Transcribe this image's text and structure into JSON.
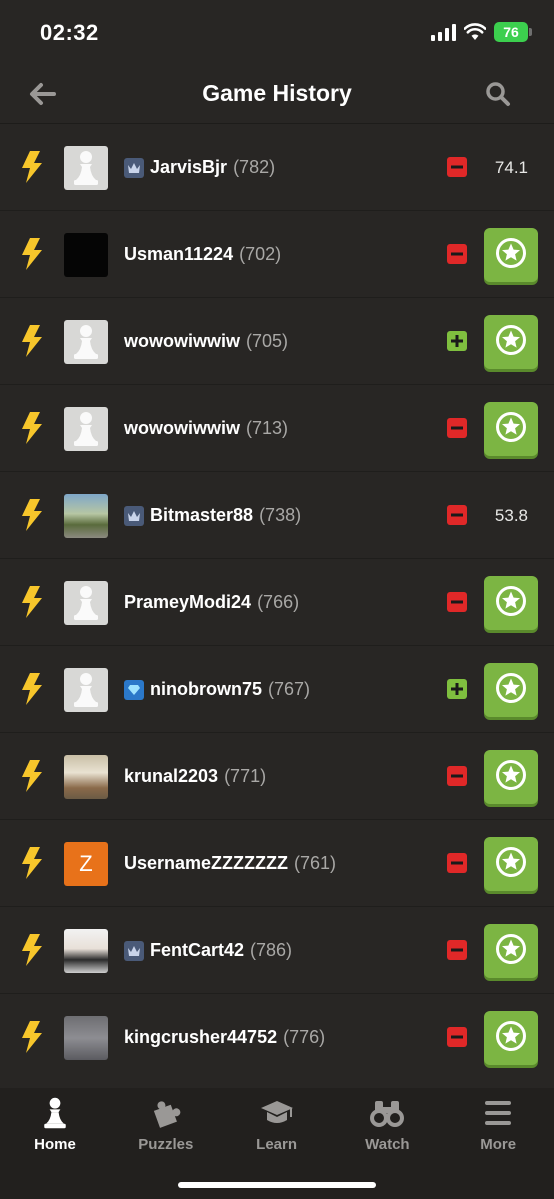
{
  "status": {
    "time": "02:32",
    "battery": "76"
  },
  "header": {
    "title": "Game History",
    "back_icon": "arrow-left-icon",
    "search_icon": "search-icon"
  },
  "games": [
    {
      "avatar": "pawn",
      "badge": "crown",
      "username": "JarvisBjr",
      "rating": "(782)",
      "result": "loss",
      "accuracy": "74.1"
    },
    {
      "avatar": "black",
      "badge": "",
      "username": "Usman11224",
      "rating": "(702)",
      "result": "loss",
      "accuracy": ""
    },
    {
      "avatar": "pawn",
      "badge": "",
      "username": "wowowiwwiw",
      "rating": "(705)",
      "result": "win",
      "accuracy": ""
    },
    {
      "avatar": "pawn",
      "badge": "",
      "username": "wowowiwwiw",
      "rating": "(713)",
      "result": "loss",
      "accuracy": ""
    },
    {
      "avatar": "photo1",
      "badge": "crown",
      "username": "Bitmaster88",
      "rating": "(738)",
      "result": "loss",
      "accuracy": "53.8"
    },
    {
      "avatar": "pawn",
      "badge": "",
      "username": "PrameyModi24",
      "rating": "(766)",
      "result": "loss",
      "accuracy": ""
    },
    {
      "avatar": "pawn",
      "badge": "diamond",
      "username": "ninobrown75",
      "rating": "(767)",
      "result": "win",
      "accuracy": ""
    },
    {
      "avatar": "photo2",
      "badge": "",
      "username": "krunal2203",
      "rating": "(771)",
      "result": "loss",
      "accuracy": ""
    },
    {
      "avatar": "letter",
      "avatar_letter": "Z",
      "badge": "",
      "username": "UsernameZZZZZZZ",
      "rating": "(761)",
      "result": "loss",
      "accuracy": ""
    },
    {
      "avatar": "photo3",
      "badge": "crown",
      "username": "FentCart42",
      "rating": "(786)",
      "result": "loss",
      "accuracy": ""
    },
    {
      "avatar": "photo4",
      "badge": "",
      "username": "kingcrusher44752",
      "rating": "(776)",
      "result": "loss",
      "accuracy": ""
    }
  ],
  "nav": [
    {
      "label": "Home",
      "icon": "pawn-icon",
      "active": true
    },
    {
      "label": "Puzzles",
      "icon": "puzzle-icon",
      "active": false
    },
    {
      "label": "Learn",
      "icon": "graduation-cap-icon",
      "active": false
    },
    {
      "label": "Watch",
      "icon": "binoculars-icon",
      "active": false
    },
    {
      "label": "More",
      "icon": "menu-icon",
      "active": false
    }
  ],
  "colors": {
    "background": "#282624",
    "loss": "#e02828",
    "win": "#7fbf3f",
    "review_button": "#7cb543",
    "bolt": "#f7c62b"
  }
}
